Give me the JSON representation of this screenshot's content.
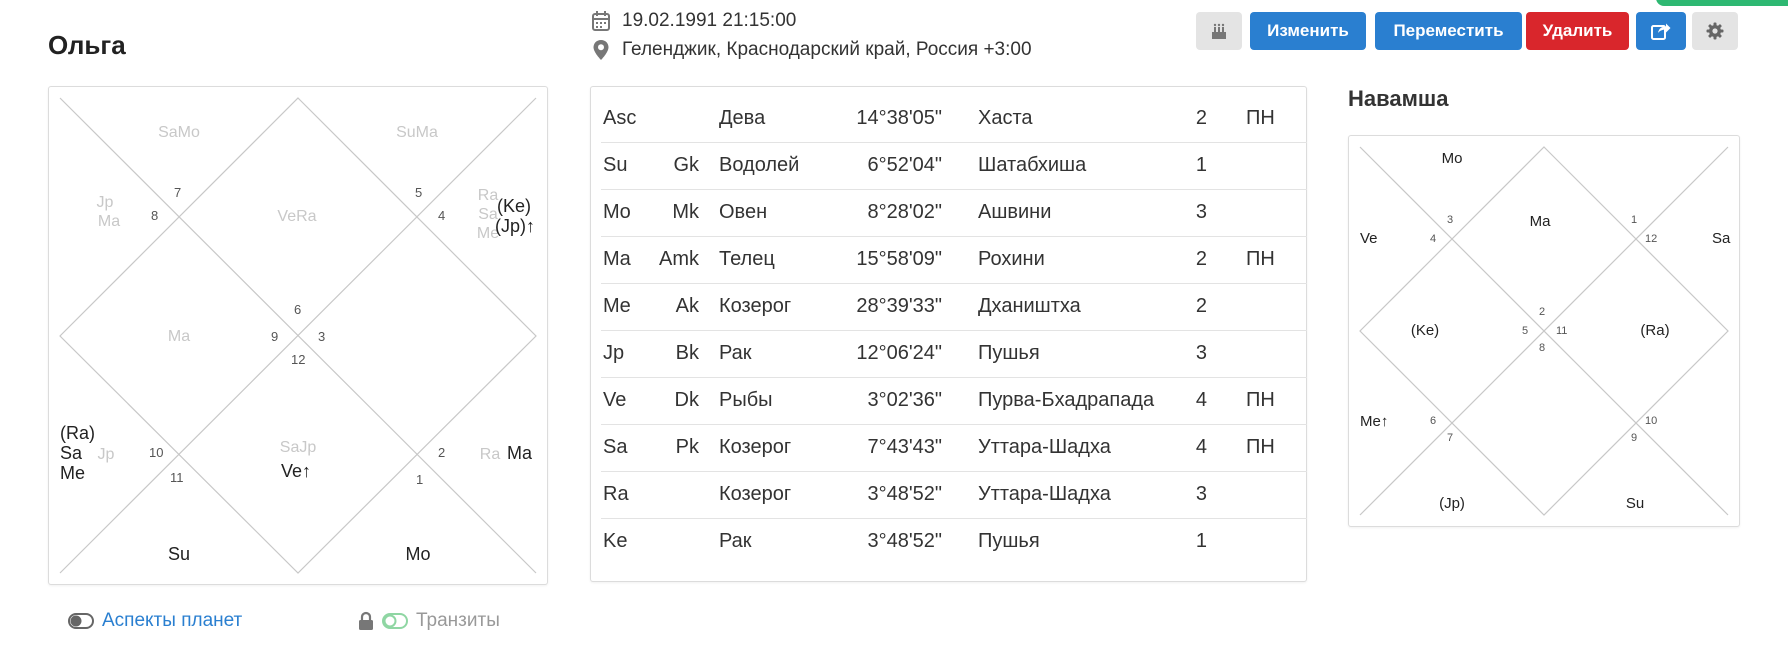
{
  "profile": {
    "name": "Ольга",
    "datetime": "19.02.1991 21:15:00",
    "location": "Геленджик, Краснодарский край, Россия +3:00"
  },
  "toolbar": {
    "cake_icon": "cake-icon",
    "edit_label": "Изменить",
    "move_label": "Переместить",
    "delete_label": "Удалить",
    "share_icon": "share-icon",
    "settings_icon": "gear-icon",
    "colors": {
      "blue": "#2a7fd0",
      "red": "#d9262c",
      "gray": "#e4e4e4"
    }
  },
  "rasi_chart": {
    "houses": [
      "1",
      "2",
      "3",
      "4",
      "5",
      "6",
      "7",
      "8",
      "9",
      "10",
      "11",
      "12"
    ],
    "faded_labels": [
      "SaMo",
      "SuMa",
      "Jp",
      "Ma",
      "VeRa",
      "Ra",
      "Sa",
      "Me",
      "Ma",
      "SaJp",
      "Jp",
      "Ra"
    ],
    "planets": [
      "(Ke)",
      "(Jp)↑",
      "(Ra)",
      "Sa",
      "Me",
      "Ve↑",
      "Ma",
      "Su",
      "Mo"
    ]
  },
  "planets_table": {
    "rows": [
      {
        "planet": "Asc",
        "karaka": "",
        "sign": "Дева",
        "degree": "14°38'05\"",
        "nakshatra": "Хаста",
        "pada": "2",
        "status": "ПН"
      },
      {
        "planet": "Su",
        "karaka": "Gk",
        "sign": "Водолей",
        "degree": "6°52'04\"",
        "nakshatra": "Шатабхиша",
        "pada": "1",
        "status": ""
      },
      {
        "planet": "Mo",
        "karaka": "Mk",
        "sign": "Овен",
        "degree": "8°28'02\"",
        "nakshatra": "Ашвини",
        "pada": "3",
        "status": ""
      },
      {
        "planet": "Ma",
        "karaka": "Amk",
        "sign": "Телец",
        "degree": "15°58'09\"",
        "nakshatra": "Рохини",
        "pada": "2",
        "status": "ПН"
      },
      {
        "planet": "Me",
        "karaka": "Ak",
        "sign": "Козерог",
        "degree": "28°39'33\"",
        "nakshatra": "Дхаништха",
        "pada": "2",
        "status": ""
      },
      {
        "planet": "Jp",
        "karaka": "Bk",
        "sign": "Рак",
        "degree": "12°06'24\"",
        "nakshatra": "Пушья",
        "pada": "3",
        "status": ""
      },
      {
        "planet": "Ve",
        "karaka": "Dk",
        "sign": "Рыбы",
        "degree": "3°02'36\"",
        "nakshatra": "Пурва-Бхадрапада",
        "pada": "4",
        "status": "ПН"
      },
      {
        "planet": "Sa",
        "karaka": "Pk",
        "sign": "Козерог",
        "degree": "7°43'43\"",
        "nakshatra": "Уттара-Шадха",
        "pada": "4",
        "status": "ПН"
      },
      {
        "planet": "Ra",
        "karaka": "",
        "sign": "Козерог",
        "degree": "3°48'52\"",
        "nakshatra": "Уттара-Шадха",
        "pada": "3",
        "status": ""
      },
      {
        "planet": "Ke",
        "karaka": "",
        "sign": "Рак",
        "degree": "3°48'52\"",
        "nakshatra": "Пушья",
        "pada": "1",
        "status": ""
      }
    ]
  },
  "navamsa": {
    "title": "Навамша",
    "houses": [
      "1",
      "2",
      "3",
      "4",
      "5",
      "6",
      "7",
      "8",
      "9",
      "10",
      "11",
      "12"
    ],
    "planets": [
      "Mo",
      "Ve",
      "Ma",
      "Sa",
      "(Ke)",
      "(Ra)",
      "Me↑",
      "(Jp)",
      "Su"
    ]
  },
  "toggles": {
    "aspects_label": "Аспекты планет",
    "transits_label": "Транзиты",
    "lock_icon": "lock-icon"
  }
}
